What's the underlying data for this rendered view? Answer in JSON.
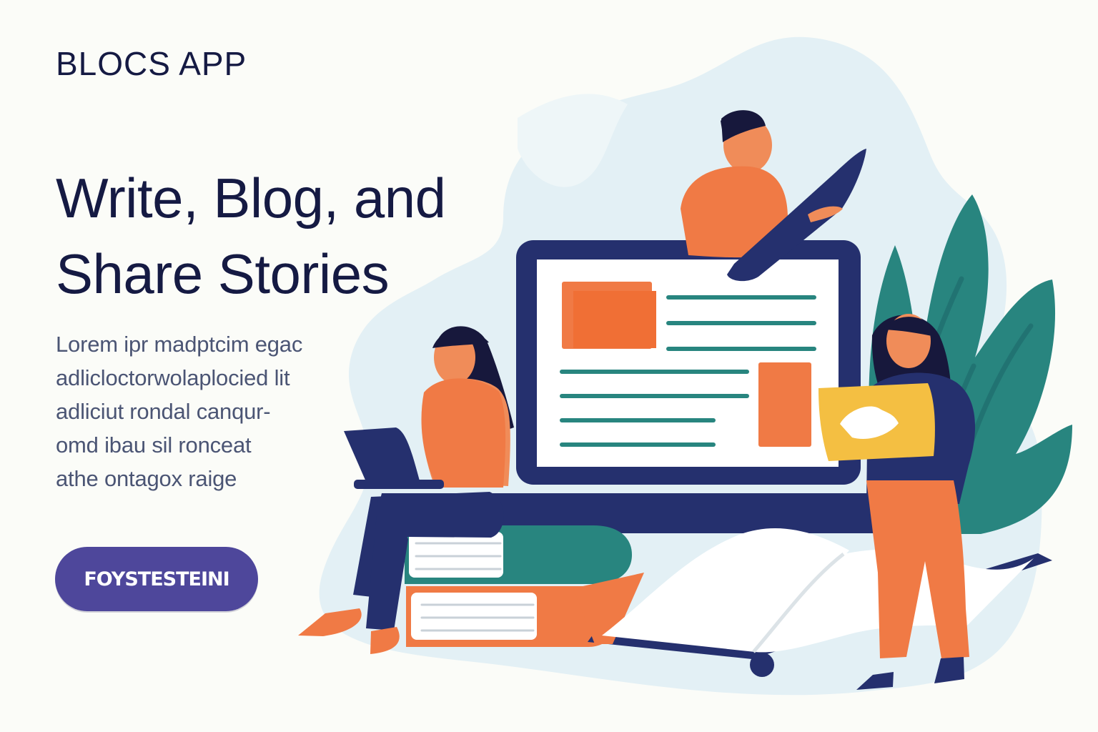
{
  "brand": {
    "name": "BLOCS APP"
  },
  "hero": {
    "headline_line1": "Write, Blog, and",
    "headline_line2": "Share Stories",
    "body_lines": [
      "Lorem ipr madptcim egac",
      "adlicloctorwolaplocied lit",
      "adliciut rondal canqur-",
      "omd ibau sil ronceat",
      "athe ontagox raige"
    ],
    "cta_label": "FOYSTESTEINI"
  },
  "illustration": {
    "description_icon": "blogging-team-illustration",
    "colors": {
      "navy": "#25306e",
      "orange": "#f07a45",
      "teal": "#28857f",
      "yellow": "#f4bf42",
      "light_blue": "#e3f0f5",
      "white": "#ffffff"
    }
  }
}
